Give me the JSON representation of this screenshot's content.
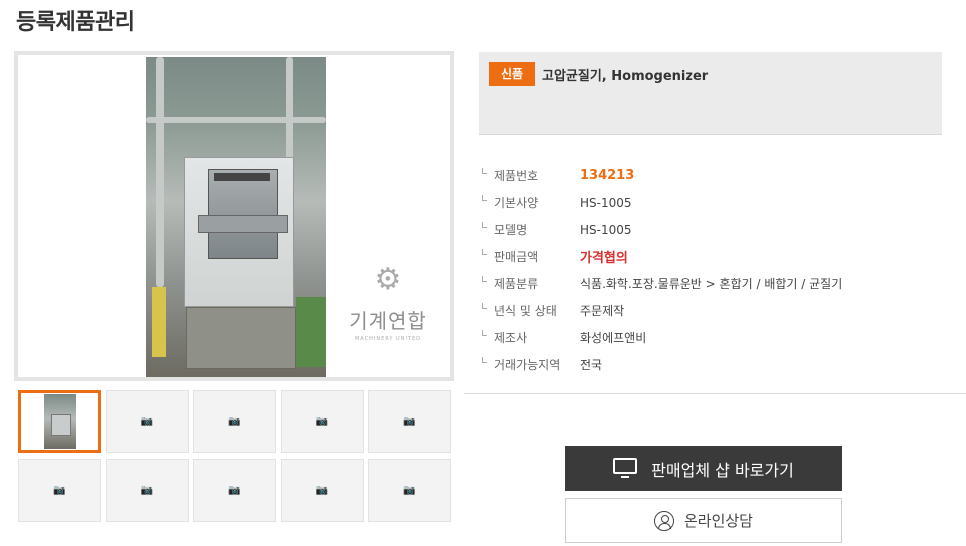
{
  "page": {
    "title": "등록제품관리"
  },
  "gallery": {
    "watermark": {
      "name": "기계연합",
      "sub": "MACHINERY UNITED",
      "icon": "gear-icon"
    },
    "thumbnails": [
      {
        "kind": "photo",
        "active": true
      },
      {
        "kind": "placeholder"
      },
      {
        "kind": "placeholder"
      },
      {
        "kind": "placeholder"
      },
      {
        "kind": "placeholder"
      },
      {
        "kind": "placeholder"
      },
      {
        "kind": "placeholder"
      },
      {
        "kind": "placeholder"
      },
      {
        "kind": "placeholder"
      },
      {
        "kind": "placeholder"
      }
    ],
    "placeholder_icon": "camera-icon"
  },
  "product": {
    "badge": "신품",
    "title": "고압균질기, Homogenizer"
  },
  "specs": [
    {
      "label": "제품번호",
      "value": "134213",
      "style": "orange"
    },
    {
      "label": "기본사양",
      "value": "HS-1005",
      "style": ""
    },
    {
      "label": "모델명",
      "value": "HS-1005",
      "style": ""
    },
    {
      "label": "판매금액",
      "value": "가격협의",
      "style": "red"
    },
    {
      "label": "제품분류",
      "value": "식품.화학.포장.물류운반 > 혼합기 / 배합기 / 균질기",
      "style": ""
    },
    {
      "label": "년식 및 상태",
      "value": "주문제작",
      "style": ""
    },
    {
      "label": "제조사",
      "value": "화성에프앤비",
      "style": ""
    },
    {
      "label": "거래가능지역",
      "value": "전국",
      "style": ""
    }
  ],
  "buttons": {
    "shop": {
      "label": "판매업체 샵 바로가기",
      "icon": "monitor-icon"
    },
    "consult": {
      "label": "온라인상담",
      "icon": "person-icon"
    }
  },
  "colors": {
    "accent": "#ec6d12",
    "price": "#d9302f",
    "dark_button": "#3a3a3a"
  }
}
